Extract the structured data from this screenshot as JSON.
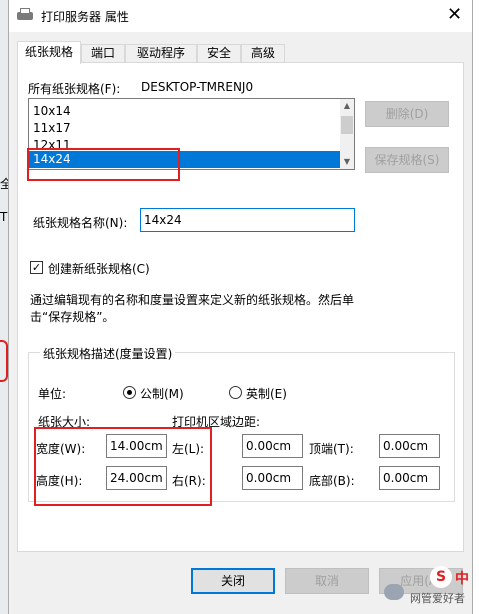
{
  "title": "打印服务器 属性",
  "close_glyph": "✕",
  "tabs": [
    "纸张规格",
    "端口",
    "驱动程序",
    "安全",
    "高级"
  ],
  "forms": {
    "all_label": "所有纸张规格(F):",
    "server_name": "DESKTOP-TMRENJ0",
    "items": [
      "10x14",
      "11x17",
      "12x11",
      "14x24"
    ],
    "selected": "14x24",
    "delete_label": "删除(D)",
    "save_label": "保存规格(S)",
    "name_label": "纸张规格名称(N):",
    "name_value": "14x24",
    "create_new_label": "创建新纸张规格(C)",
    "create_new_checked": true,
    "help_line1": "通过编辑现有的名称和度量设置来定义新的纸张规格。然后单",
    "help_line2": "击“保存规格”。"
  },
  "description": {
    "group_title": "纸张规格描述(度量设置)",
    "unit_label": "单位:",
    "metric_label": "公制(M)",
    "english_label": "英制(E)",
    "metric_selected": true,
    "paper_size_label": "纸张大小:",
    "margins_label": "打印机区域边距:",
    "width_label": "宽度(W):",
    "width_value": "14.00cm",
    "height_label": "高度(H):",
    "height_value": "24.00cm",
    "left_label": "左(L):",
    "left_value": "0.00cm",
    "right_label": "右(R):",
    "right_value": "0.00cm",
    "top_label": "顶端(T):",
    "top_value": "0.00cm",
    "bottom_label": "底部(B):",
    "bottom_value": "0.00cm"
  },
  "footer": {
    "close_label": "关闭",
    "cancel_label": "取消",
    "apply_label": "应用(A)"
  },
  "background": {
    "frag_1": "全",
    "frag_2": "T"
  },
  "watermark": {
    "text": "网管爱好者",
    "badge": "S",
    "cn_glyph": "中"
  }
}
